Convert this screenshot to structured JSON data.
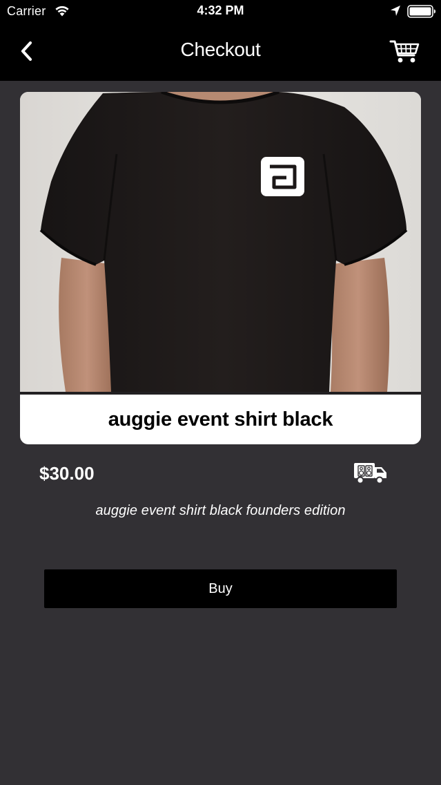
{
  "status_bar": {
    "carrier": "Carrier",
    "time": "4:32 PM"
  },
  "nav": {
    "title": "Checkout",
    "back_icon": "chevron-left-icon",
    "cart_icon": "cart-icon"
  },
  "product": {
    "title": "auggie event shirt black",
    "price": "$30.00",
    "description": "auggie event shirt black founders edition",
    "shipping_icon": "delivery-truck-icon"
  },
  "actions": {
    "buy_label": "Buy"
  },
  "colors": {
    "background": "#323034",
    "header": "#000000",
    "card": "#ffffff",
    "button": "#000000"
  }
}
